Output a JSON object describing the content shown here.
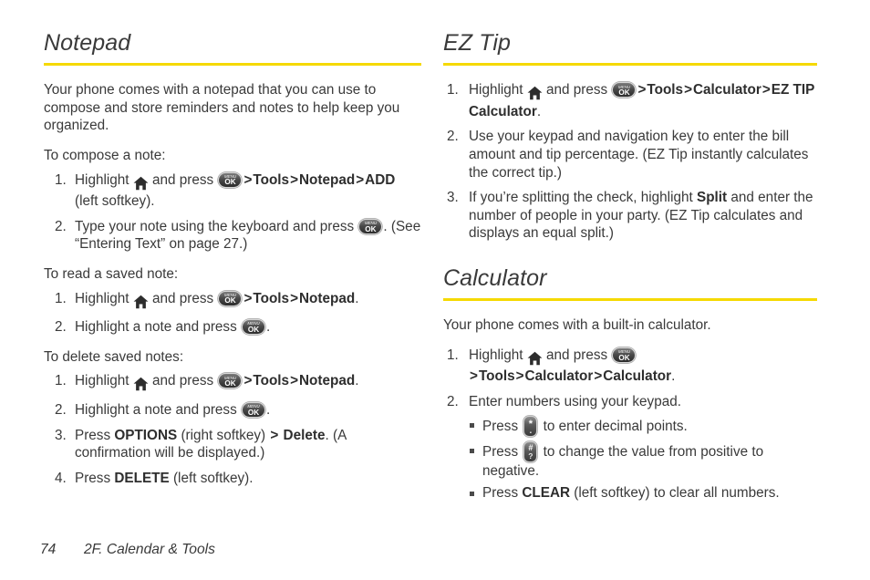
{
  "document": {
    "type": "phone-user-guide-page",
    "accent_color": "#f5d900",
    "text_color": "#3a3a3a"
  },
  "icons": {
    "home": {
      "name": "home-icon",
      "label": "Home"
    },
    "menu_ok": {
      "name": "menu-ok-key-icon",
      "top_label": "MENU",
      "bottom_label": "OK"
    },
    "star_key": {
      "name": "star-key-icon",
      "top_label": "*",
      "bottom_label": "."
    },
    "pound_key": {
      "name": "pound-key-icon",
      "top_label": "#",
      "bottom_label": "?"
    }
  },
  "left_column": {
    "heading": "Notepad",
    "intro": "Your phone comes with a notepad that you can use to compose and store reminders and notes to help keep you organized.",
    "compose": {
      "lead_in": "To compose a note:",
      "steps": [
        {
          "parts": [
            {
              "t": "text",
              "v": "Highlight "
            },
            {
              "t": "icon",
              "v": "home"
            },
            {
              "t": "text",
              "v": " and press "
            },
            {
              "t": "icon",
              "v": "menu_ok"
            },
            {
              "t": "gt",
              "v": ">"
            },
            {
              "t": "bold",
              "v": "Tools"
            },
            {
              "t": "gt",
              "v": ">"
            },
            {
              "t": "bold",
              "v": "Notepad"
            },
            {
              "t": "gt",
              "v": ">"
            },
            {
              "t": "bold",
              "v": "ADD"
            },
            {
              "t": "text",
              "v": " (left softkey)."
            }
          ]
        },
        {
          "parts": [
            {
              "t": "text",
              "v": "Type your note using the keyboard and press "
            },
            {
              "t": "icon",
              "v": "menu_ok"
            },
            {
              "t": "text",
              "v": ". (See “Entering Text” on page 27.)"
            }
          ]
        }
      ]
    },
    "read": {
      "lead_in": "To read a saved note:",
      "steps": [
        {
          "parts": [
            {
              "t": "text",
              "v": "Highlight "
            },
            {
              "t": "icon",
              "v": "home"
            },
            {
              "t": "text",
              "v": " and press "
            },
            {
              "t": "icon",
              "v": "menu_ok"
            },
            {
              "t": "gt",
              "v": ">"
            },
            {
              "t": "bold",
              "v": "Tools"
            },
            {
              "t": "gt",
              "v": ">"
            },
            {
              "t": "bold",
              "v": "Notepad"
            },
            {
              "t": "text",
              "v": "."
            }
          ]
        },
        {
          "parts": [
            {
              "t": "text",
              "v": "Highlight a note and press "
            },
            {
              "t": "icon",
              "v": "menu_ok"
            },
            {
              "t": "text",
              "v": "."
            }
          ]
        }
      ]
    },
    "delete": {
      "lead_in": "To delete saved notes:",
      "steps": [
        {
          "parts": [
            {
              "t": "text",
              "v": "Highlight "
            },
            {
              "t": "icon",
              "v": "home"
            },
            {
              "t": "text",
              "v": " and press "
            },
            {
              "t": "icon",
              "v": "menu_ok"
            },
            {
              "t": "gt",
              "v": ">"
            },
            {
              "t": "bold",
              "v": "Tools"
            },
            {
              "t": "gt",
              "v": ">"
            },
            {
              "t": "bold",
              "v": "Notepad"
            },
            {
              "t": "text",
              "v": "."
            }
          ]
        },
        {
          "parts": [
            {
              "t": "text",
              "v": "Highlight a note and press "
            },
            {
              "t": "icon",
              "v": "menu_ok"
            },
            {
              "t": "text",
              "v": "."
            }
          ]
        },
        {
          "parts": [
            {
              "t": "text",
              "v": "Press "
            },
            {
              "t": "bold",
              "v": "OPTIONS"
            },
            {
              "t": "text",
              "v": " (right softkey) "
            },
            {
              "t": "gt",
              "v": ">"
            },
            {
              "t": "text",
              "v": " "
            },
            {
              "t": "bold",
              "v": "Delete"
            },
            {
              "t": "text",
              "v": ". (A confirmation will be displayed.)"
            }
          ]
        },
        {
          "parts": [
            {
              "t": "text",
              "v": "Press "
            },
            {
              "t": "bold",
              "v": "DELETE"
            },
            {
              "t": "text",
              "v": " (left softkey)."
            }
          ]
        }
      ]
    }
  },
  "right_column": {
    "ez_tip": {
      "heading": "EZ Tip",
      "steps": [
        {
          "parts": [
            {
              "t": "text",
              "v": "Highlight "
            },
            {
              "t": "icon",
              "v": "home"
            },
            {
              "t": "text",
              "v": " and press "
            },
            {
              "t": "icon",
              "v": "menu_ok"
            },
            {
              "t": "gt",
              "v": ">"
            },
            {
              "t": "bold",
              "v": "Tools"
            },
            {
              "t": "gt",
              "v": ">"
            },
            {
              "t": "bold",
              "v": "Calculator"
            },
            {
              "t": "gt",
              "v": ">"
            },
            {
              "t": "bold",
              "v": "EZ TIP Calculator"
            },
            {
              "t": "text",
              "v": "."
            }
          ]
        },
        {
          "parts": [
            {
              "t": "text",
              "v": "Use your keypad and navigation key to enter the bill amount and tip percentage. (EZ Tip instantly calculates the correct tip.)"
            }
          ]
        },
        {
          "parts": [
            {
              "t": "text",
              "v": "If you’re splitting the check, highlight "
            },
            {
              "t": "bold",
              "v": "Split"
            },
            {
              "t": "text",
              "v": " and enter the number of people in your party. (EZ Tip calculates and displays an equal split.)"
            }
          ]
        }
      ]
    },
    "calculator": {
      "heading": "Calculator",
      "intro": "Your phone comes with a built-in calculator.",
      "steps": [
        {
          "parts": [
            {
              "t": "text",
              "v": "Highlight "
            },
            {
              "t": "icon",
              "v": "home"
            },
            {
              "t": "text",
              "v": " and press "
            },
            {
              "t": "icon",
              "v": "menu_ok"
            },
            {
              "t": "gt",
              "v": ">"
            },
            {
              "t": "bold",
              "v": "Tools"
            },
            {
              "t": "gt",
              "v": ">"
            },
            {
              "t": "bold",
              "v": "Calculator"
            },
            {
              "t": "gt",
              "v": ">"
            },
            {
              "t": "bold",
              "v": "Calculator"
            },
            {
              "t": "text",
              "v": "."
            }
          ]
        },
        {
          "parts": [
            {
              "t": "text",
              "v": "Enter numbers using your keypad."
            }
          ],
          "bullets": [
            {
              "parts": [
                {
                  "t": "text",
                  "v": "Press "
                },
                {
                  "t": "icon",
                  "v": "star_key"
                },
                {
                  "t": "text",
                  "v": " to enter decimal points."
                }
              ]
            },
            {
              "parts": [
                {
                  "t": "text",
                  "v": "Press "
                },
                {
                  "t": "icon",
                  "v": "pound_key"
                },
                {
                  "t": "text",
                  "v": " to change the value from positive to negative."
                }
              ]
            },
            {
              "parts": [
                {
                  "t": "text",
                  "v": "Press "
                },
                {
                  "t": "bold",
                  "v": "CLEAR"
                },
                {
                  "t": "text",
                  "v": " (left softkey) to clear all numbers."
                }
              ]
            }
          ]
        }
      ]
    }
  },
  "footer": {
    "page_number": "74",
    "chapter": "2F. Calendar & Tools"
  }
}
